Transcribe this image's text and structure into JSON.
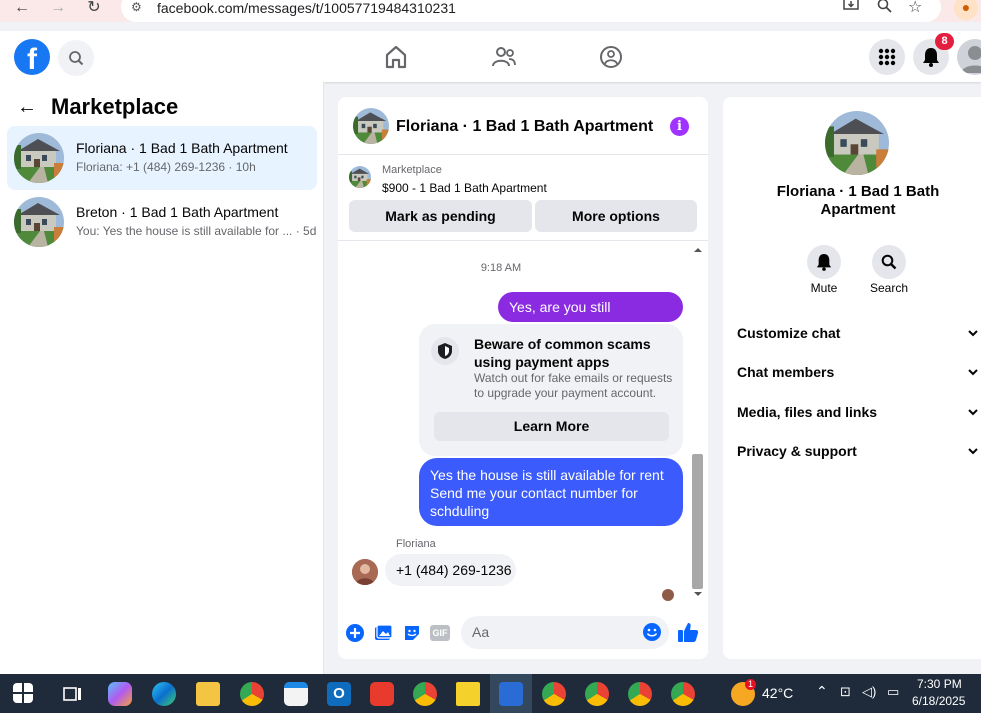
{
  "browser": {
    "url": "facebook.com/messages/t/10057719484310231"
  },
  "header": {
    "logo_letter": "f",
    "notifications_count": "8"
  },
  "sidebar": {
    "title": "Marketplace",
    "conversations": [
      {
        "title": "Floriana · 1 Bad 1 Bath Apartment",
        "preview": "Floriana: +1 (484) 269-1236 · 10h"
      },
      {
        "title": "Breton · 1 Bad 1 Bath Apartment",
        "preview": "You: Yes the house is still available for ... · 5d"
      }
    ]
  },
  "chat": {
    "title": "Floriana · 1 Bad 1 Bath Apartment",
    "info_glyph": "i",
    "listing_source": "Marketplace",
    "listing": "$900 - 1 Bad 1 Bath Apartment",
    "mark_pending_label": "Mark as pending",
    "more_options_label": "More options",
    "timestamp": "9:18 AM",
    "messages": {
      "out_1": "Yes, are you still interested?",
      "scam_title": "Beware of common scams using payment apps",
      "scam_body": "Watch out for fake emails or requests to upgrade your payment account.",
      "learn_more_label": "Learn More",
      "out_2": "Yes the house is still available for rent Send me your contact number for schduling",
      "sender_name": "Floriana",
      "in_1": "+1 (484) 269-1236"
    },
    "composer_placeholder": "Aa",
    "gif_label": "GIF"
  },
  "details": {
    "title": "Floriana · 1 Bad 1 Bath Apartment",
    "mute_label": "Mute",
    "search_label": "Search",
    "sections": [
      "Customize chat",
      "Chat members",
      "Media, files and links",
      "Privacy & support"
    ]
  },
  "taskbar": {
    "weather_temp": "42°C",
    "weather_badge": "1",
    "time": "7:30 PM",
    "date": "6/18/2025"
  },
  "colors": {
    "fb_blue": "#1877f2",
    "purple_bubble": "#8a2be2",
    "blue_bubble": "#3b5bfd",
    "active_conversation": "#e7f3ff",
    "badge_red": "#e41e3f"
  }
}
